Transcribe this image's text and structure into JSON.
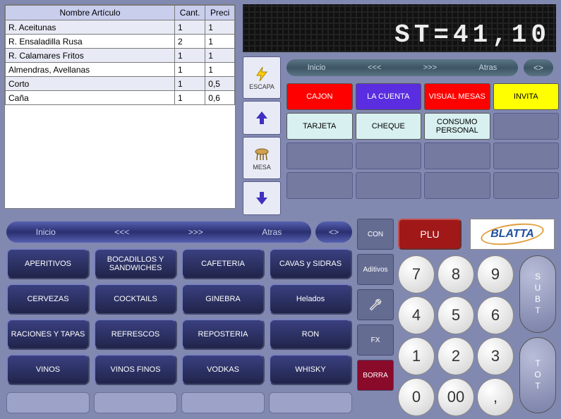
{
  "order_table": {
    "headers": [
      "Nombre Artículo",
      "Cant.",
      "Preci"
    ],
    "rows": [
      {
        "name": "R. Aceitunas",
        "qty": "1",
        "price": "1"
      },
      {
        "name": "R. Ensaladilla Rusa",
        "qty": "2",
        "price": "1"
      },
      {
        "name": "R. Calamares Fritos",
        "qty": "1",
        "price": "1"
      },
      {
        "name": "Almendras, Avellanas",
        "qty": "1",
        "price": "1"
      },
      {
        "name": "Corto",
        "qty": "1",
        "price": "0,5"
      },
      {
        "name": "Caña",
        "qty": "1",
        "price": "0,6"
      }
    ]
  },
  "led_display": "ST=41,10",
  "nav_buttons": {
    "escapa": "ESCAPA",
    "mesa": "MESA"
  },
  "top_nav": {
    "inicio": "Inicio",
    "prev": "<<<",
    "next": ">>>",
    "atras": "Atras",
    "diamond": "<>"
  },
  "actions": {
    "cajon": "CAJON",
    "lacuenta": "LA CUENTA",
    "visualmesas": "VISUAL MESAS",
    "invita": "INVITA",
    "tarjeta": "TARJETA",
    "cheque": "CHEQUE",
    "consumopersonal": "CONSUMO PERSONAL"
  },
  "cat_nav": {
    "inicio": "Inicio",
    "prev": "<<<",
    "next": ">>>",
    "atras": "Atras",
    "diamond": "<>"
  },
  "categories": [
    "APERITIVOS",
    "BOCADILLOS Y SANDWICHES",
    "CAFETERIA",
    "CAVAS y SIDRAS",
    "CERVEZAS",
    "COCKTAILS",
    "GINEBRA",
    "Helados",
    "RACIONES Y TAPAS",
    "REFRESCOS",
    "REPOSTERIA",
    "RON",
    "VINOS",
    "VINOS FINOS",
    "VODKAS",
    "WHISKY"
  ],
  "side": {
    "con": "CON",
    "aditivos": "Aditivos",
    "fx": "FX",
    "borra": "BORRA"
  },
  "plu": "PLU",
  "logo": "BLATTA",
  "numpad": [
    "7",
    "8",
    "9",
    "4",
    "5",
    "6",
    "1",
    "2",
    "3",
    "0",
    "00",
    ","
  ],
  "totals": {
    "subt": "SUBT",
    "tot": "TOT"
  }
}
